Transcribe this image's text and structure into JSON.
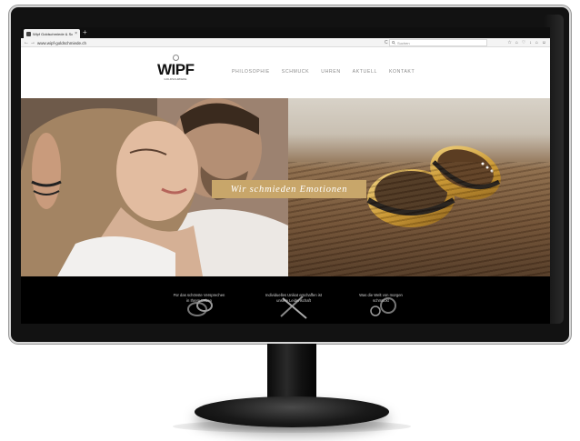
{
  "browser": {
    "tab_title": "Wipf Goldschmiede & Sc...",
    "tab_close": "×",
    "new_tab": "+",
    "url": "www.wipf-goldschmiede.ch",
    "search_placeholder": "Suchen",
    "back": "←",
    "forward": "→",
    "reload": "C",
    "toolbar_icons": [
      "☆",
      "⌂",
      "♡",
      "↓",
      "⌂",
      "☺"
    ]
  },
  "site": {
    "logo_text": "WIPF",
    "logo_sub": "GOLDSCHMIEDE",
    "nav": [
      "PHILOSOPHIE",
      "SCHMUCK",
      "UHREN",
      "AKTUELL",
      "KONTAKT"
    ]
  },
  "hero": {
    "slogan": "Wir schmieden Emotionen"
  },
  "promos": [
    {
      "line1": "Für das schönste Versprechen",
      "line2": "in Ihrem Leben"
    },
    {
      "line1": "Individuelles Unikat erschaffen ist",
      "line2": "unsere Leidenschaft"
    },
    {
      "line1": "Was die Welt von morgen",
      "line2": "schmückt"
    }
  ],
  "colors": {
    "slogan_bg": "#c8a66a",
    "nav_text": "#8a8a8a",
    "strip_bg": "#000000"
  }
}
